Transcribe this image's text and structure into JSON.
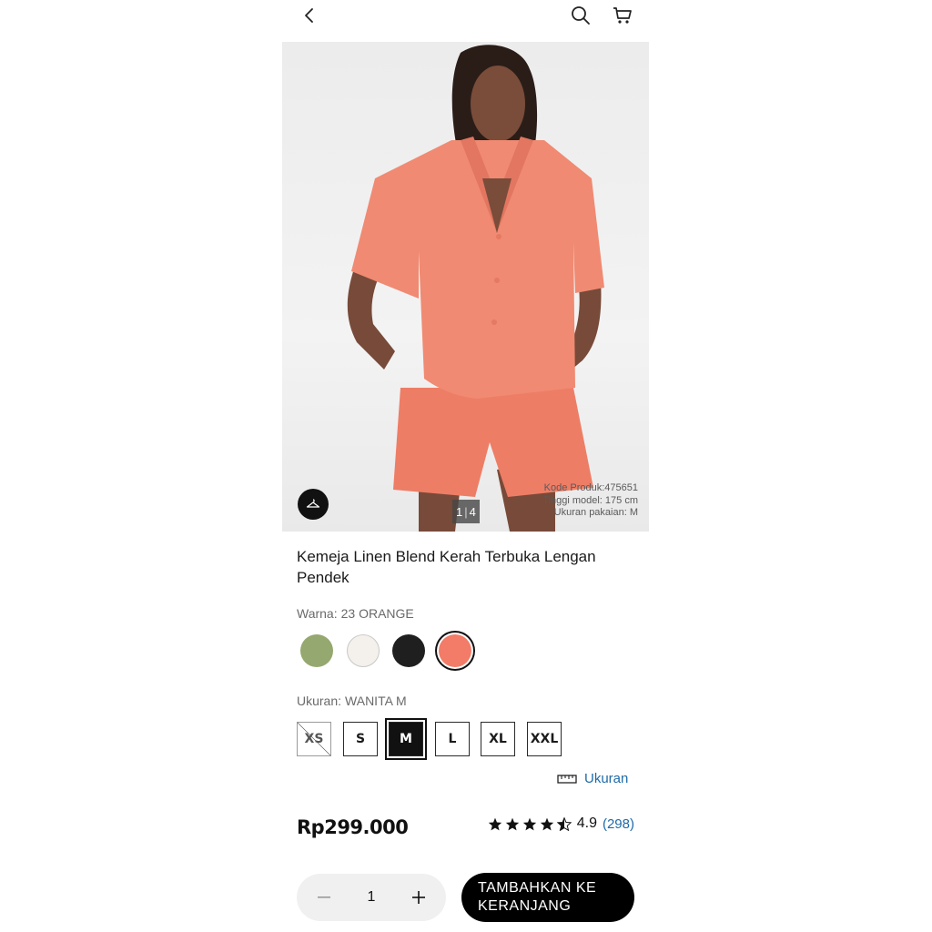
{
  "topbar": {
    "back_icon": "chevron-left-icon",
    "search_icon": "search-icon",
    "cart_icon": "cart-icon"
  },
  "gallery": {
    "pager_current": "1",
    "pager_total": "4",
    "meta_lines": [
      "Kode Produk:475651",
      "Tinggi model: 175 cm",
      "Ukuran pakaian: M"
    ],
    "hanger_icon": "hanger-icon"
  },
  "product": {
    "title": "Kemeja Linen Blend Kerah Terbuka Lengan Pendek",
    "color_label": "Warna:",
    "color_value": "23 ORANGE",
    "colors": [
      "#95a86f",
      "#f4f1ec",
      "#1f1f1f",
      "#f27c68"
    ],
    "selected_color_index": 3,
    "size_label": "Ukuran:",
    "size_value": "WANITA M",
    "sizes": [
      "XS",
      "S",
      "M",
      "L",
      "XL",
      "XXL"
    ],
    "size_guide_label": "Ukuran",
    "price": "Rp299.000",
    "rating_score": "4.9",
    "rating_count": "(298)",
    "rating_value": 4.5
  },
  "cart": {
    "quantity": "1",
    "add_label": "TAMBAHKAN KE KERANJANG"
  },
  "colors": {
    "accent_link": "#1f6aa8",
    "primary_button": "#000000",
    "product_orange": "#f27c68"
  }
}
